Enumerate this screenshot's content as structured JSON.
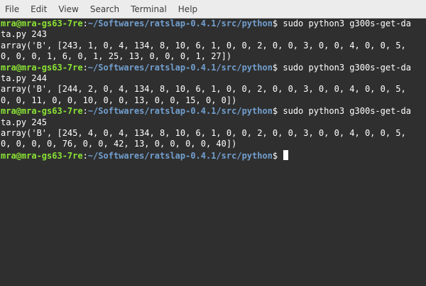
{
  "menu": {
    "items": [
      "File",
      "Edit",
      "View",
      "Search",
      "Terminal",
      "Help"
    ]
  },
  "prompt": {
    "user_host": "mra@mra-gs63-7re",
    "colon": ":",
    "path": "~/Softwares/ratslap-0.4.1/src/python",
    "dollar": "$"
  },
  "terminal": {
    "blocks": [
      {
        "command_head": " sudo python3 g300s-get-da",
        "command_tail": "ta.py 243",
        "output": [
          "array('B', [243, 1, 0, 4, 134, 8, 10, 6, 1, 0, 0, 2, 0, 0, 3, 0, 0, 4, 0, 0, 5,",
          "0, 0, 0, 1, 6, 0, 1, 25, 13, 0, 0, 0, 1, 27])"
        ]
      },
      {
        "command_head": " sudo python3 g300s-get-da",
        "command_tail": "ta.py 244",
        "output": [
          "array('B', [244, 2, 0, 4, 134, 8, 10, 6, 1, 0, 0, 2, 0, 0, 3, 0, 0, 4, 0, 0, 5,",
          "0, 0, 11, 0, 0, 10, 0, 0, 13, 0, 0, 15, 0, 0])"
        ]
      },
      {
        "command_head": " sudo python3 g300s-get-da",
        "command_tail": "ta.py 245",
        "output": [
          "array('B', [245, 4, 0, 4, 134, 8, 10, 6, 1, 0, 0, 2, 0, 0, 3, 0, 0, 4, 0, 0, 5,",
          "0, 0, 0, 0, 76, 0, 0, 42, 13, 0, 0, 0, 0, 40])"
        ]
      }
    ]
  }
}
